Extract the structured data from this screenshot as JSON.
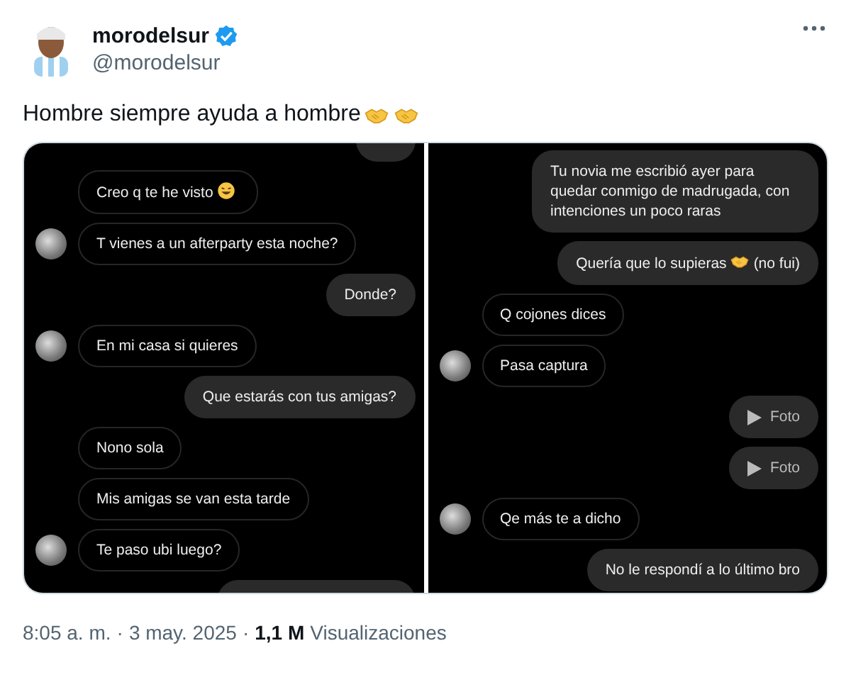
{
  "author": {
    "name": "morodelsur",
    "verified": true,
    "handle": "@morodelsur"
  },
  "text": "Hombre siempre ayuda a hombre",
  "panels": [
    {
      "messages": [
        {
          "kind": "partial"
        },
        {
          "kind": "received",
          "text": "Creo q te he visto",
          "emoji": true,
          "avatar": false
        },
        {
          "kind": "received",
          "text": "T vienes a un afterparty esta noche?",
          "avatar": true
        },
        {
          "kind": "sent",
          "text": "Donde?"
        },
        {
          "kind": "received",
          "text": "En mi casa si quieres",
          "avatar": true
        },
        {
          "kind": "sent",
          "text": "Que estarás con tus amigas?"
        },
        {
          "kind": "received",
          "text": "Nono sola",
          "avatar": false
        },
        {
          "kind": "received",
          "text": "Mis amigas se van esta tarde",
          "avatar": false
        },
        {
          "kind": "received",
          "text": "Te paso ubi luego?",
          "avatar": true
        },
        {
          "kind": "partial"
        }
      ]
    },
    {
      "messages": [
        {
          "kind": "sent",
          "text": "Tu novia me escribió ayer para quedar conmigo de madrugada, con intenciones un poco raras"
        },
        {
          "kind": "sent",
          "text": "Quería que lo supieras",
          "emoji": true,
          "text_after": "(no fui)"
        },
        {
          "kind": "received",
          "text": "Q cojones dices",
          "avatar": false
        },
        {
          "kind": "received",
          "text": "Pasa captura",
          "avatar": true
        },
        {
          "kind": "photo",
          "text": "Foto"
        },
        {
          "kind": "photo",
          "text": "Foto"
        },
        {
          "kind": "received",
          "text": "Qe más te a dicho",
          "avatar": true
        },
        {
          "kind": "sent",
          "text": "No le respondí a lo último bro"
        }
      ]
    }
  ],
  "footer": {
    "time": "8:05 a. m.",
    "separators": [
      "·",
      "·"
    ],
    "date": "3 may. 2025",
    "views_count": "1,1 M",
    "views_label": "Visualizaciones"
  }
}
